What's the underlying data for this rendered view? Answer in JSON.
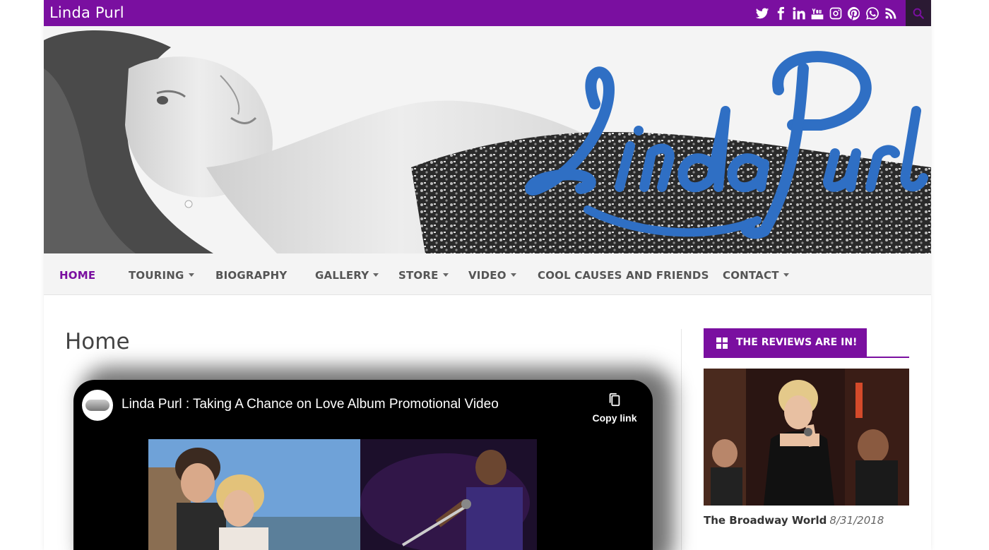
{
  "site": {
    "title": "Linda Purl",
    "accent": "#7a0fa0"
  },
  "social_icons": [
    "twitter-icon",
    "facebook-icon",
    "linkedin-icon",
    "youtube-icon",
    "instagram-icon",
    "pinterest-icon",
    "whatsapp-icon",
    "rss-icon"
  ],
  "banner": {
    "logo_text": "Linda Purl",
    "logo_color": "#2f6fc4"
  },
  "nav": {
    "items": [
      {
        "label": "HOME",
        "active": true,
        "dropdown": false
      },
      {
        "label": "TOURING",
        "active": false,
        "dropdown": true
      },
      {
        "label": "BIOGRAPHY",
        "active": false,
        "dropdown": false
      },
      {
        "label": "GALLERY",
        "active": false,
        "dropdown": true
      },
      {
        "label": "STORE",
        "active": false,
        "dropdown": true
      },
      {
        "label": "VIDEO",
        "active": false,
        "dropdown": true
      },
      {
        "label": "COOL CAUSES AND FRIENDS",
        "active": false,
        "dropdown": false
      },
      {
        "label": "CONTACT",
        "active": false,
        "dropdown": true
      }
    ]
  },
  "main": {
    "heading": "Home",
    "video": {
      "title": "Linda Purl : Taking A Chance on Love Album Promotional Video",
      "copy_link": "Copy link"
    }
  },
  "sidebar": {
    "widget_title": "THE REVIEWS ARE IN!",
    "review": {
      "source": "The Broadway World",
      "date": "8/31/2018"
    }
  }
}
